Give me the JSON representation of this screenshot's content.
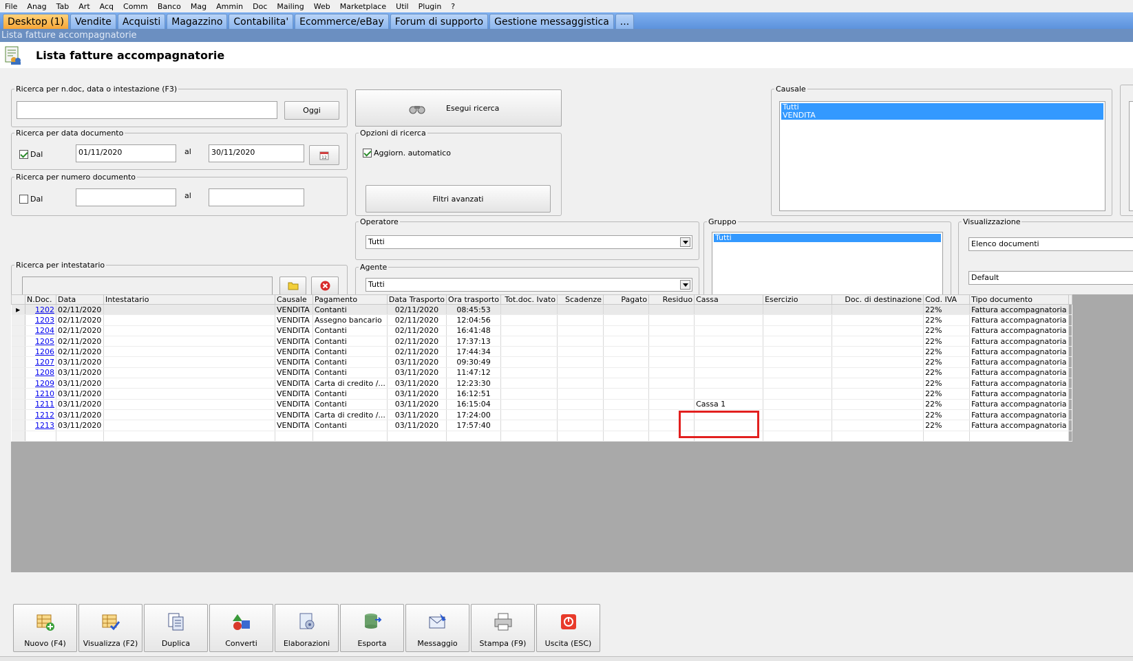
{
  "menu": [
    "File",
    "Anag",
    "Tab",
    "Art",
    "Acq",
    "Comm",
    "Banco",
    "Mag",
    "Ammin",
    "Doc",
    "Mailing",
    "Web",
    "Marketplace",
    "Util",
    "Plugin",
    "?"
  ],
  "tabs": [
    "Desktop (1)",
    "Vendite",
    "Acquisti",
    "Magazzino",
    "Contabilita'",
    "Ecommerce/eBay",
    "Forum di supporto",
    "Gestione messaggistica",
    "..."
  ],
  "window_strip": "Lista fatture accompagnatorie",
  "page_title": "Lista fatture accompagnatorie",
  "search": {
    "legend": "Ricerca per n.doc, data o intestazione (F3)",
    "value": "",
    "today_button": "Oggi",
    "run_button": "Esegui ricerca"
  },
  "date_search": {
    "legend": "Ricerca per data documento",
    "from_checkbox": "Dal",
    "from_checked": true,
    "from_value": "01/11/2020",
    "to_label": "al",
    "to_value": "30/11/2020"
  },
  "number_search": {
    "legend": "Ricerca per numero documento",
    "from_checkbox": "Dal",
    "from_checked": false,
    "from_value": "",
    "to_label": "al",
    "to_value": ""
  },
  "options": {
    "legend": "Opzioni di ricerca",
    "auto_update_label": "Aggiorn. automatico",
    "auto_update_checked": true,
    "advanced_filters_button": "Filtri avanzati"
  },
  "causale": {
    "legend": "Causale",
    "items": [
      "Tutti",
      "VENDITA"
    ]
  },
  "operatore": {
    "legend": "Operatore",
    "value": "Tutti"
  },
  "agente": {
    "legend": "Agente",
    "value": "Tutti"
  },
  "gruppo": {
    "legend": "Gruppo",
    "items": [
      "Tutti"
    ]
  },
  "visualizzazione": {
    "legend": "Visualizzazione",
    "mode": "Elenco documenti",
    "layout": "Default"
  },
  "intestatario": {
    "legend": "Ricerca per intestatario",
    "value": ""
  },
  "grid": {
    "columns": [
      "N.Doc.",
      "Data",
      "Intestatario",
      "Causale",
      "Pagamento",
      "Data Trasporto",
      "Ora trasporto",
      "Tot.doc. Ivato",
      "Scadenze",
      "Pagato",
      "Residuo",
      "Cassa",
      "Esercizio",
      "Doc. di destinazione",
      "Cod. IVA",
      "Tipo documento"
    ],
    "rows": [
      {
        "ndoc": "1202",
        "data": "02/11/2020",
        "causale": "VENDITA",
        "pagamento": "Contanti",
        "data_trasporto": "02/11/2020",
        "ora_trasporto": "08:45:53",
        "cassa": "",
        "cod_iva": "22%",
        "tipo": "Fattura accompagnatoria"
      },
      {
        "ndoc": "1203",
        "data": "02/11/2020",
        "causale": "VENDITA",
        "pagamento": "Assegno bancario",
        "data_trasporto": "02/11/2020",
        "ora_trasporto": "12:04:56",
        "cassa": "",
        "cod_iva": "22%",
        "tipo": "Fattura accompagnatoria"
      },
      {
        "ndoc": "1204",
        "data": "02/11/2020",
        "causale": "VENDITA",
        "pagamento": "Contanti",
        "data_trasporto": "02/11/2020",
        "ora_trasporto": "16:41:48",
        "cassa": "",
        "cod_iva": "22%",
        "tipo": "Fattura accompagnatoria"
      },
      {
        "ndoc": "1205",
        "data": "02/11/2020",
        "causale": "VENDITA",
        "pagamento": "Contanti",
        "data_trasporto": "02/11/2020",
        "ora_trasporto": "17:37:13",
        "cassa": "",
        "cod_iva": "22%",
        "tipo": "Fattura accompagnatoria"
      },
      {
        "ndoc": "1206",
        "data": "02/11/2020",
        "causale": "VENDITA",
        "pagamento": "Contanti",
        "data_trasporto": "02/11/2020",
        "ora_trasporto": "17:44:34",
        "cassa": "",
        "cod_iva": "22%",
        "tipo": "Fattura accompagnatoria"
      },
      {
        "ndoc": "1207",
        "data": "03/11/2020",
        "causale": "VENDITA",
        "pagamento": "Contanti",
        "data_trasporto": "03/11/2020",
        "ora_trasporto": "09:30:49",
        "cassa": "",
        "cod_iva": "22%",
        "tipo": "Fattura accompagnatoria"
      },
      {
        "ndoc": "1208",
        "data": "03/11/2020",
        "causale": "VENDITA",
        "pagamento": "Contanti",
        "data_trasporto": "03/11/2020",
        "ora_trasporto": "11:47:12",
        "cassa": "",
        "cod_iva": "22%",
        "tipo": "Fattura accompagnatoria"
      },
      {
        "ndoc": "1209",
        "data": "03/11/2020",
        "causale": "VENDITA",
        "pagamento": "Carta di credito /...",
        "data_trasporto": "03/11/2020",
        "ora_trasporto": "12:23:30",
        "cassa": "",
        "cod_iva": "22%",
        "tipo": "Fattura accompagnatoria"
      },
      {
        "ndoc": "1210",
        "data": "03/11/2020",
        "causale": "VENDITA",
        "pagamento": "Contanti",
        "data_trasporto": "03/11/2020",
        "ora_trasporto": "16:12:51",
        "cassa": "",
        "cod_iva": "22%",
        "tipo": "Fattura accompagnatoria"
      },
      {
        "ndoc": "1211",
        "data": "03/11/2020",
        "causale": "VENDITA",
        "pagamento": "Contanti",
        "data_trasporto": "03/11/2020",
        "ora_trasporto": "16:15:04",
        "cassa": "Cassa 1",
        "cod_iva": "22%",
        "tipo": "Fattura accompagnatoria"
      },
      {
        "ndoc": "1212",
        "data": "03/11/2020",
        "causale": "VENDITA",
        "pagamento": "Carta di credito /...",
        "data_trasporto": "03/11/2020",
        "ora_trasporto": "17:24:00",
        "cassa": "",
        "cod_iva": "22%",
        "tipo": "Fattura accompagnatoria"
      },
      {
        "ndoc": "1213",
        "data": "03/11/2020",
        "causale": "VENDITA",
        "pagamento": "Contanti",
        "data_trasporto": "03/11/2020",
        "ora_trasporto": "17:57:40",
        "cassa": "",
        "cod_iva": "22%",
        "tipo": "Fattura accompagnatoria"
      }
    ]
  },
  "toolbar": [
    {
      "label": "Nuovo (F4)",
      "icon": "new-document-icon"
    },
    {
      "label": "Visualizza (F2)",
      "icon": "view-document-icon"
    },
    {
      "label": "Duplica",
      "icon": "duplicate-icon"
    },
    {
      "label": "Converti",
      "icon": "convert-icon"
    },
    {
      "label": "Elaborazioni",
      "icon": "process-icon"
    },
    {
      "label": "Esporta",
      "icon": "export-icon"
    },
    {
      "label": "Messaggio",
      "icon": "message-icon"
    },
    {
      "label": "Stampa (F9)",
      "icon": "print-icon"
    },
    {
      "label": "Uscita (ESC)",
      "icon": "exit-icon"
    }
  ],
  "colors": {
    "tab_active": "#f6a637",
    "tab_bar": "#5c92dc",
    "selection": "#3399ff",
    "highlight_box": "#e2201f",
    "link": "#0000ee"
  }
}
